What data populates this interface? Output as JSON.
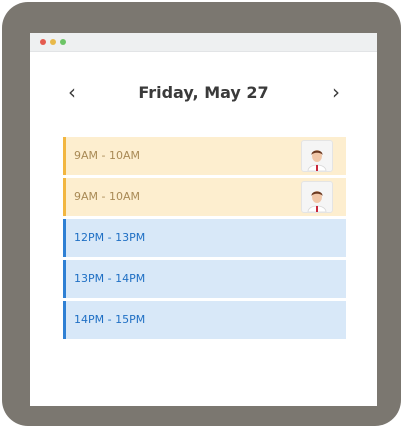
{
  "header": {
    "prev_icon": "chevron-left-icon",
    "title": "Friday, May 27",
    "next_icon": "chevron-right-icon"
  },
  "colors": {
    "frame": "#7b7770",
    "personal_bg": "#fdeecf",
    "personal_accent": "#f2b640",
    "work_bg": "#d8e8f8",
    "work_accent": "#2f80d4"
  },
  "events": [
    {
      "time": "9AM - 10AM",
      "type": "personal",
      "avatar": "person-avatar"
    },
    {
      "time": "9AM - 10AM",
      "type": "personal",
      "avatar": "person-avatar"
    },
    {
      "time": "12PM - 13PM",
      "type": "work"
    },
    {
      "time": "13PM - 14PM",
      "type": "work"
    },
    {
      "time": "14PM - 15PM",
      "type": "work"
    }
  ]
}
